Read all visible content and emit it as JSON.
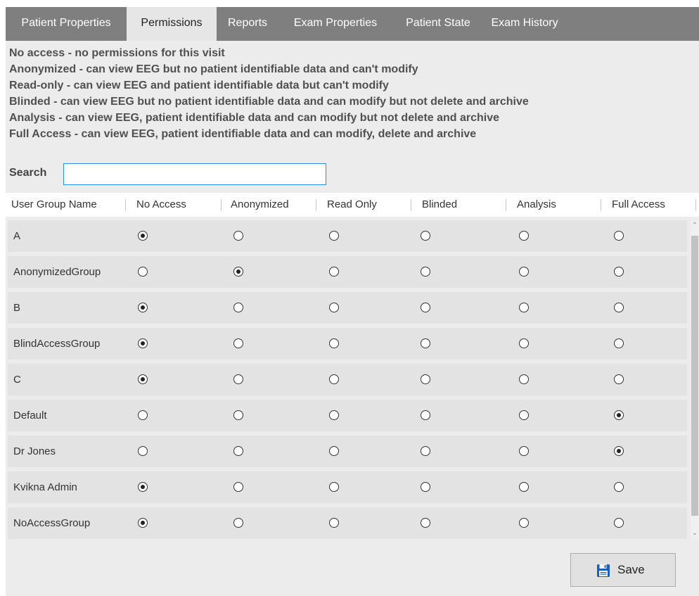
{
  "tabs": [
    {
      "label": "Patient Properties",
      "active": false
    },
    {
      "label": "Permissions",
      "active": true
    },
    {
      "label": "Reports",
      "active": false
    },
    {
      "label": "Exam Properties",
      "active": false
    },
    {
      "label": "Patient State",
      "active": false
    },
    {
      "label": "Exam History",
      "active": false
    }
  ],
  "descriptions": [
    "No access - no permissions for this visit",
    "Anonymized - can view EEG but no patient identifiable data and can't modify",
    "Read-only - can view EEG and patient identifiable data but can't modify",
    "Blinded - can view EEG but no patient identifiable data and can modify but not delete and archive",
    "Analysis - can view EEG, patient identifiable data and can modify but not delete and archive",
    "Full Access - can view EEG, patient identifiable data and can modify, delete and archive"
  ],
  "search": {
    "label": "Search",
    "value": "",
    "placeholder": ""
  },
  "table": {
    "columns": [
      "User Group Name",
      "No Access",
      "Anonymized",
      "Read Only",
      "Blinded",
      "Analysis",
      "Full Access"
    ],
    "rows": [
      {
        "name": "A",
        "selected": "No Access"
      },
      {
        "name": "AnonymizedGroup",
        "selected": "Anonymized"
      },
      {
        "name": "B",
        "selected": "No Access"
      },
      {
        "name": "BlindAccessGroup",
        "selected": "No Access"
      },
      {
        "name": "C",
        "selected": "No Access"
      },
      {
        "name": "Default",
        "selected": "Full Access"
      },
      {
        "name": "Dr Jones",
        "selected": "Full Access"
      },
      {
        "name": "Kvikna Admin",
        "selected": "No Access"
      },
      {
        "name": "NoAccessGroup",
        "selected": "No Access"
      }
    ]
  },
  "footer": {
    "save_label": "Save",
    "save_icon": "floppy-disk-icon"
  },
  "colors": {
    "tab_bar": "#7f7f7f",
    "panel": "#ececec",
    "row": "#e3e3e3",
    "focus": "#2a8de0",
    "save_icon": "#1e5fb4"
  }
}
